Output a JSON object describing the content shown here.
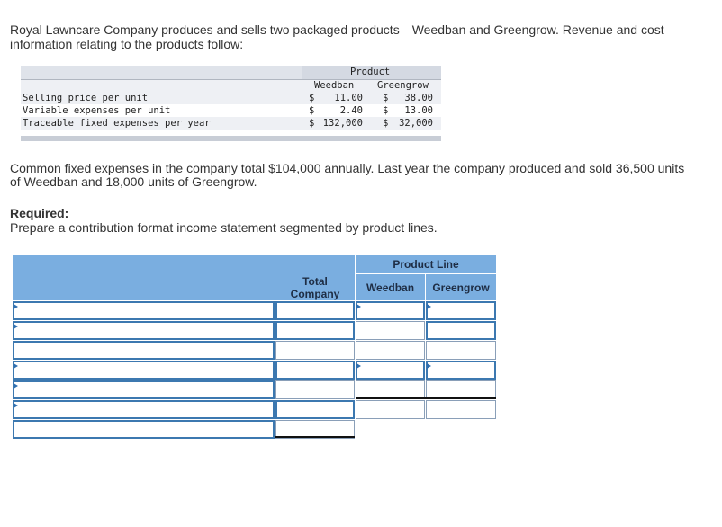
{
  "intro": "Royal Lawncare Company produces and sells two packaged products—Weedban and Greengrow. Revenue and cost information relating to the products follow:",
  "info_table": {
    "group_header": "Product",
    "col1": "Weedban",
    "col2": "Greengrow",
    "rows": [
      {
        "label": "Selling price per unit",
        "c1_sym": "$",
        "c1_val": "11.00",
        "c2_sym": "$",
        "c2_val": "38.00"
      },
      {
        "label": "Variable expenses per unit",
        "c1_sym": "$",
        "c1_val": "2.40",
        "c2_sym": "$",
        "c2_val": "13.00"
      },
      {
        "label": "Traceable fixed expenses per year",
        "c1_sym": "$",
        "c1_val": "132,000",
        "c2_sym": "$",
        "c2_val": "32,000"
      }
    ]
  },
  "common_text": "Common fixed expenses in the company total $104,000 annually. Last year the company produced and sold 36,500 units of Weedban and 18,000 units of Greengrow.",
  "required_heading": "Required:",
  "required_text": "Prepare a contribution format income statement segmented by product lines.",
  "worksheet": {
    "product_line_header": "Product Line",
    "total_company": "Total Company",
    "col_weedban": "Weedban",
    "col_greengrow": "Greengrow",
    "rows": [
      {
        "label": "",
        "total": "",
        "weedban": "",
        "greengrow": ""
      },
      {
        "label": "",
        "total": "",
        "weedban": "",
        "greengrow": ""
      },
      {
        "label": "",
        "total": "",
        "weedban": "",
        "greengrow": ""
      },
      {
        "label": "",
        "total": "",
        "weedban": "",
        "greengrow": ""
      },
      {
        "label": "",
        "total": "",
        "weedban": "",
        "greengrow": ""
      },
      {
        "label": "",
        "total": "",
        "weedban": "",
        "greengrow": ""
      },
      {
        "label": "",
        "total": "",
        "weedban": "",
        "greengrow": ""
      }
    ]
  },
  "colors": {
    "header_blue": "#7aaee0",
    "label_border": "#3c78b0"
  }
}
